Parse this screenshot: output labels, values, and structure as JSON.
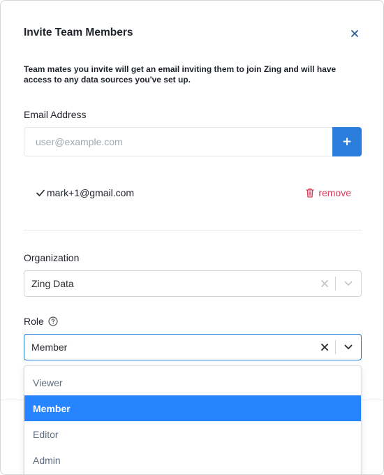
{
  "modal": {
    "title": "Invite Team Members",
    "description": "Team mates you invite will get an email inviting them to join Zing and will have access to any data sources you've set up."
  },
  "email": {
    "label": "Email Address",
    "placeholder": "user@example.com",
    "add_button": "+"
  },
  "invitees": [
    {
      "email": "mark+1@gmail.com",
      "remove_label": "remove"
    }
  ],
  "organization": {
    "label": "Organization",
    "value": "Zing Data"
  },
  "role": {
    "label": "Role",
    "value": "Member",
    "options": [
      "Viewer",
      "Member",
      "Editor",
      "Admin"
    ],
    "selected": "Member"
  },
  "colors": {
    "accent": "#2a7ddb",
    "option_highlight": "#2684ff",
    "remove": "#d63d5c"
  }
}
